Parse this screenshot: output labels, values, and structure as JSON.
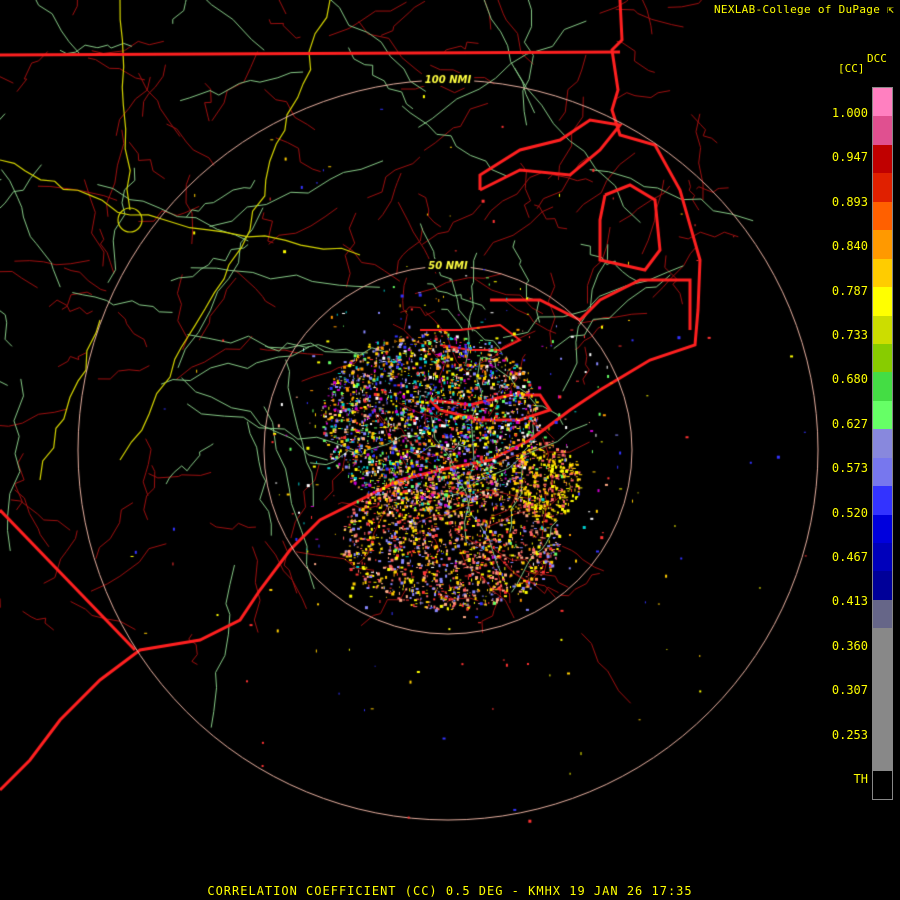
{
  "credit": "NEXLAB-College of DuPage",
  "footer": "CORRELATION COEFFICIENT (CC) 0.5 DEG - KMHX 19 JAN 26 17:35",
  "legend": {
    "code": "DCC",
    "unit": "[CC]",
    "ticks": [
      "1.000",
      "0.947",
      "0.893",
      "0.840",
      "0.787",
      "0.733",
      "0.680",
      "0.627",
      "0.573",
      "0.520",
      "0.467",
      "0.413",
      "0.360",
      "0.307",
      "0.253",
      "TH"
    ],
    "colors": [
      "#ff80c0",
      "#e05090",
      "#c00000",
      "#e02000",
      "#ff6000",
      "#ff9900",
      "#ffcc00",
      "#ffff00",
      "#ccdd00",
      "#88cc00",
      "#44dd44",
      "#66ff66",
      "#8888dd",
      "#7777ee",
      "#3333ff",
      "#0000dd",
      "#0000bb",
      "#000099",
      "#666688",
      "#888888",
      "#888888",
      "#888888",
      "#888888",
      "#888888",
      "#000000"
    ]
  },
  "range_rings": [
    {
      "label": "50 NMI"
    },
    {
      "label": "100 NMI"
    }
  ]
}
